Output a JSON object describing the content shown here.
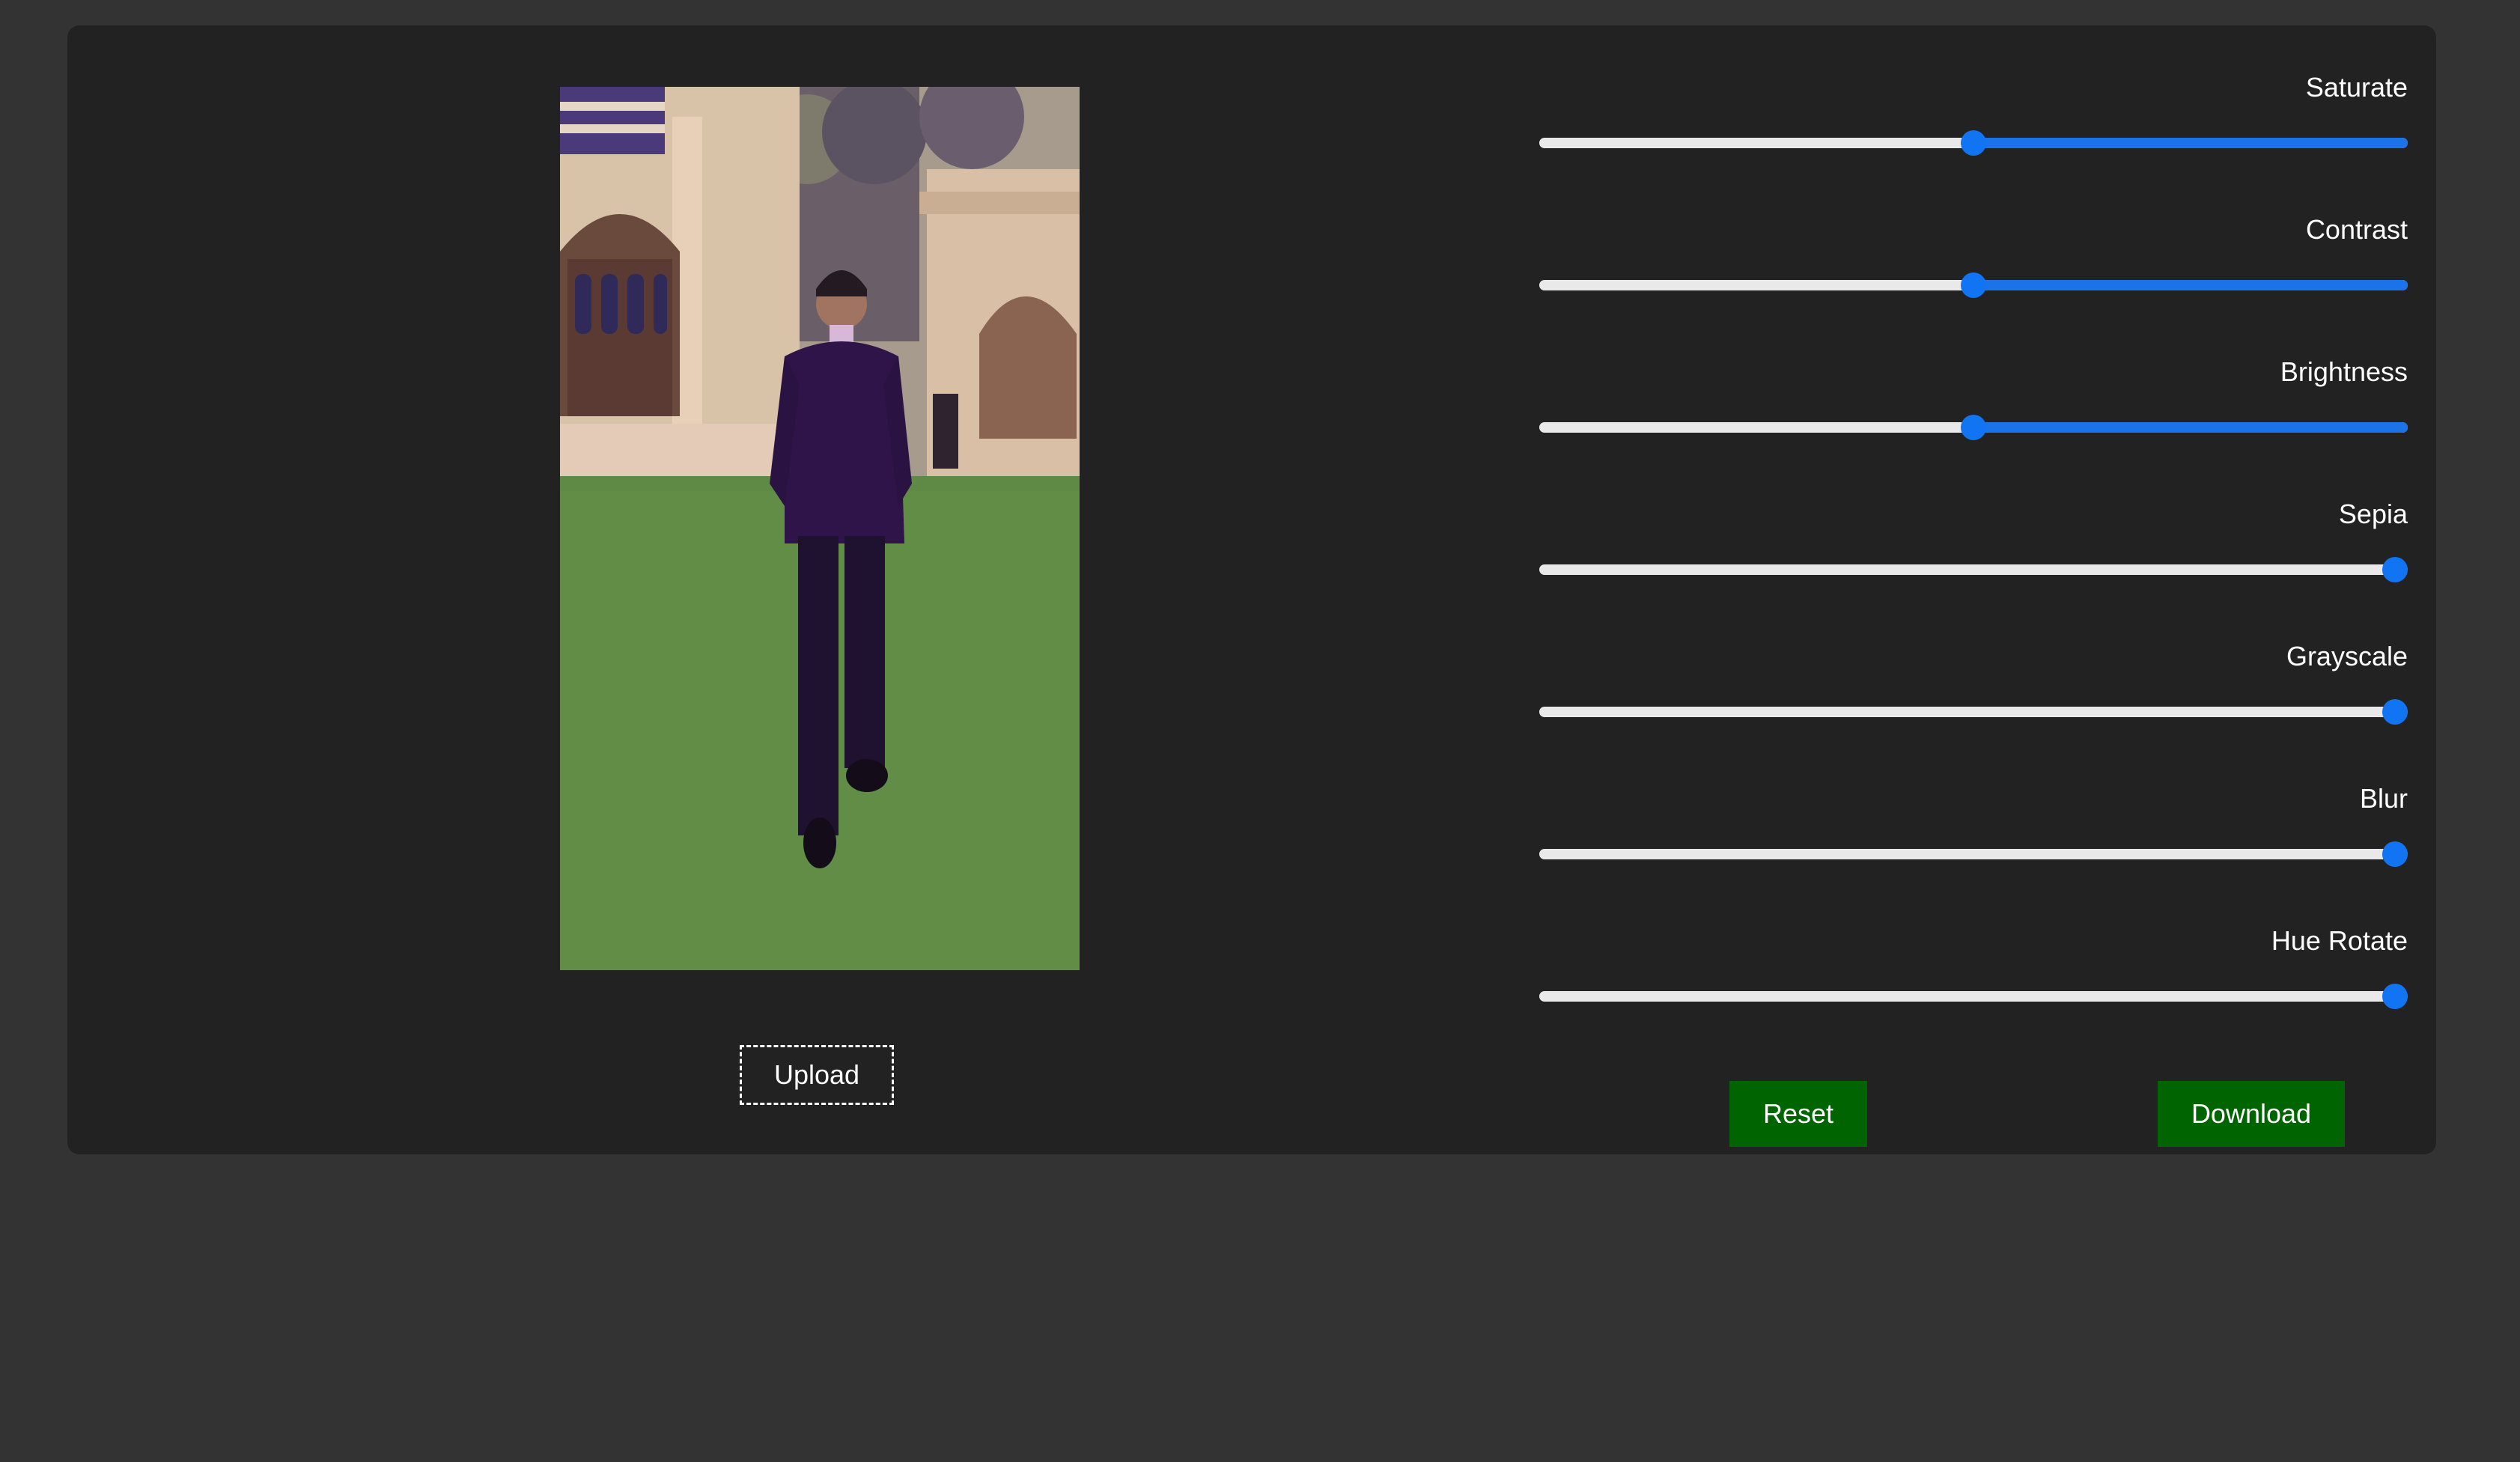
{
  "editor": {
    "preview_image": "photo of man in dark purple suit standing on grass in front of arched building",
    "upload_label": "Upload"
  },
  "controls": [
    {
      "label": "Saturate",
      "level": 0.5
    },
    {
      "label": "Contrast",
      "level": 0.5
    },
    {
      "label": "Brightness",
      "level": 0.5
    },
    {
      "label": "Sepia",
      "level": 1.0
    },
    {
      "label": "Grayscale",
      "level": 1.0
    },
    {
      "label": "Blur",
      "level": 1.0
    },
    {
      "label": "Hue Rotate",
      "level": 1.0
    }
  ],
  "actions": {
    "reset_label": "Reset",
    "download_label": "Download"
  },
  "colors": {
    "accent": "#1a73e8",
    "button": "#006400",
    "panel": "#222222",
    "background": "#333333"
  }
}
